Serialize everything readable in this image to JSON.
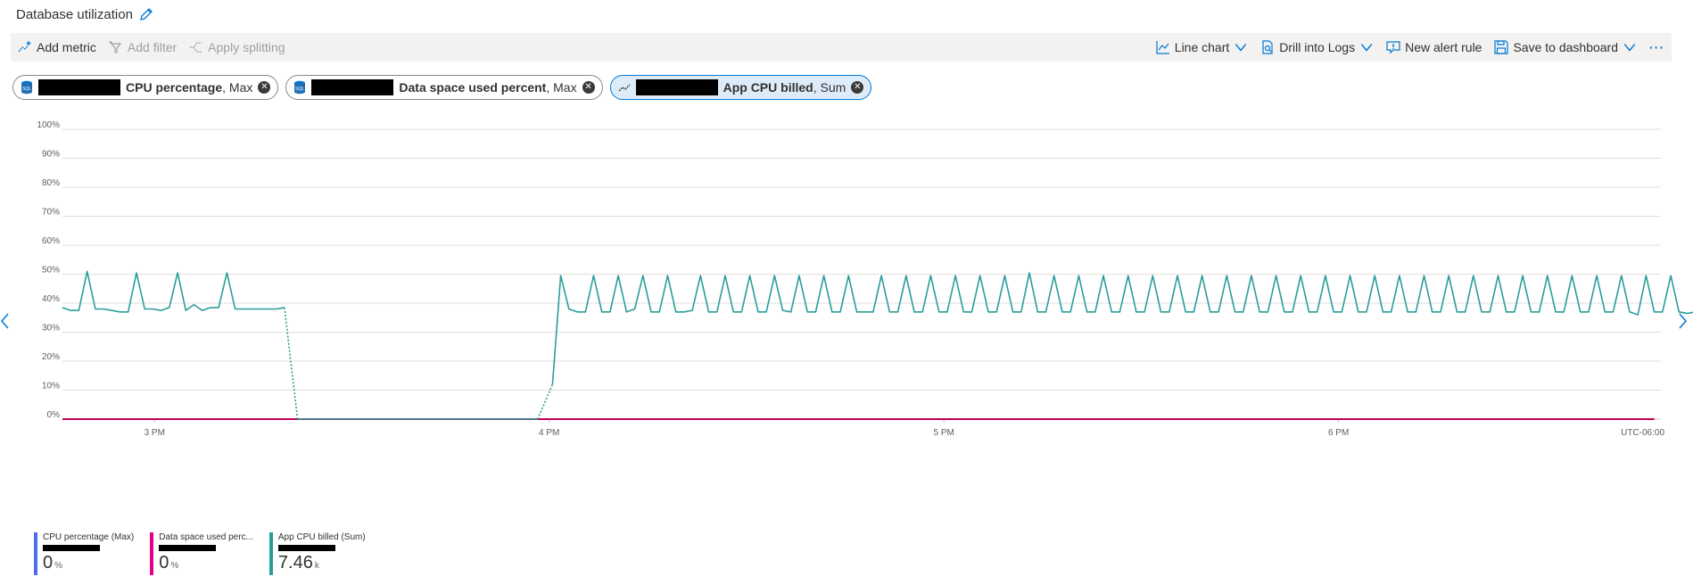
{
  "header": {
    "title": "Database utilization"
  },
  "toolbar": {
    "left": [
      {
        "label": "Add metric",
        "icon": "add-metric-icon",
        "enabled": true
      },
      {
        "label": "Add filter",
        "icon": "filter-icon",
        "enabled": false
      },
      {
        "label": "Apply splitting",
        "icon": "splitting-icon",
        "enabled": false
      }
    ],
    "right": [
      {
        "label": "Line chart",
        "icon": "line-chart-icon",
        "dropdown": true
      },
      {
        "label": "Drill into Logs",
        "icon": "logs-icon",
        "dropdown": true
      },
      {
        "label": "New alert rule",
        "icon": "alert-icon",
        "dropdown": false
      },
      {
        "label": "Save to dashboard",
        "icon": "save-icon",
        "dropdown": true
      }
    ],
    "more": "···"
  },
  "metric_pills": [
    {
      "metric": "CPU percentage",
      "agg": ", Max",
      "icon": "database-icon",
      "active": false
    },
    {
      "metric": "Data space used percent",
      "agg": ", Max",
      "icon": "database-icon",
      "active": false
    },
    {
      "metric": "App CPU billed",
      "agg": ", Sum",
      "icon": "metric-trend-icon",
      "active": true
    }
  ],
  "chart_data": {
    "type": "line",
    "y_ticks": [
      "0%",
      "10%",
      "20%",
      "30%",
      "40%",
      "50%",
      "60%",
      "70%",
      "80%",
      "90%",
      "100%"
    ],
    "ylim": [
      0,
      100
    ],
    "x_ticks": [
      {
        "label": "3 PM",
        "t": 180
      },
      {
        "label": "4 PM",
        "t": 240
      },
      {
        "label": "5 PM",
        "t": 300
      },
      {
        "label": "6 PM",
        "t": 360
      }
    ],
    "x_time_range_minutes": [
      166,
      409
    ],
    "x_unit_label": "UTC-06:00",
    "grid": true,
    "series": [
      {
        "name": "App CPU billed (Sum)",
        "color": "#2a9d9a",
        "segments": [
          {
            "style": "solid",
            "start": 166,
            "step": 1.25,
            "values": [
              38.5,
              37.5,
              37.5,
              51,
              38,
              38,
              37.5,
              37,
              37,
              50.5,
              38,
              38,
              37.5,
              38.5,
              50.5,
              37.5,
              39.5,
              37.5,
              38.5,
              38.5,
              50.5,
              38,
              38,
              38,
              38,
              38,
              38,
              38.5
            ]
          },
          {
            "style": "dotted",
            "points": [
              [
                199.75,
                38.5
              ],
              [
                201.75,
                0
              ]
            ]
          },
          {
            "style": "solid",
            "points": [
              [
                201.75,
                0
              ],
              [
                238.25,
                0
              ]
            ]
          },
          {
            "style": "dotted",
            "points": [
              [
                238.25,
                0
              ],
              [
                240.5,
                12
              ]
            ]
          },
          {
            "style": "solid",
            "start": 240.5,
            "step": 1.25,
            "values": [
              12,
              49.5,
              38,
              37,
              37,
              49.5,
              37,
              37,
              49.5,
              37,
              38,
              49.5,
              37,
              37,
              49.5,
              37,
              37,
              37.5,
              49.5,
              37,
              37,
              49.5,
              37,
              37,
              49.5,
              37,
              37,
              49.5,
              37.5,
              37,
              49.5,
              37,
              37,
              49.5,
              37,
              37,
              49.5,
              37,
              37,
              37,
              49.5,
              37,
              37,
              49.5,
              37,
              37,
              49.5,
              37,
              37,
              49.5,
              37,
              37,
              49.5,
              37,
              37,
              49.5,
              37,
              37,
              50.5,
              37,
              37,
              49.5,
              37,
              37,
              49.5,
              37,
              37,
              49.5,
              37,
              37,
              49.5,
              37,
              37,
              49.5,
              37,
              37,
              49.5,
              37,
              37,
              49.5,
              37,
              37,
              49.5,
              37,
              37,
              49.5,
              37,
              37,
              49.5,
              37,
              37,
              49.5,
              37,
              37,
              49.5,
              37,
              37,
              49.5,
              37,
              37,
              49.5,
              37,
              37,
              49.5,
              37,
              37,
              49.5,
              37,
              37,
              49.5,
              37,
              37,
              49.5,
              37,
              37,
              49.5,
              37,
              37,
              49.5,
              37,
              37,
              49.5,
              37,
              37,
              49.5,
              37,
              37,
              49.5,
              37,
              37,
              49.5,
              37,
              36,
              49.5,
              37,
              37,
              49.5,
              37,
              36.5,
              37,
              37
            ]
          }
        ]
      },
      {
        "name": "CPU percentage (Max)",
        "color": "#4f6bed",
        "segments": [
          {
            "style": "solid",
            "points": [
              [
                166,
                0
              ],
              [
                408,
                0
              ]
            ]
          }
        ]
      },
      {
        "name": "Data space used percent (Max)",
        "color": "#c30052",
        "segments": [
          {
            "style": "solid",
            "points": [
              [
                166,
                0
              ],
              [
                408,
                0
              ]
            ]
          }
        ]
      }
    ]
  },
  "legend": [
    {
      "name": "CPU percentage (Max)",
      "value": "0",
      "unit": "%",
      "color": "#4f6bed"
    },
    {
      "name": "Data space used perc...",
      "value": "0",
      "unit": "%",
      "color": "#e3008c"
    },
    {
      "name": "App CPU billed (Sum)",
      "value": "7.46",
      "unit": "k",
      "color": "#2a9d9a"
    }
  ]
}
